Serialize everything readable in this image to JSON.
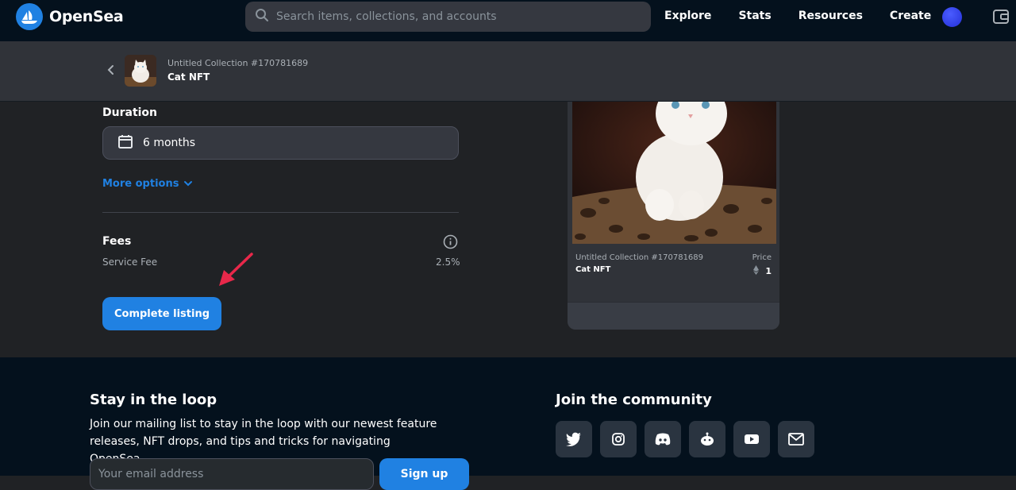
{
  "nav": {
    "logo_text": "OpenSea",
    "search_placeholder": "Search items, collections, and accounts",
    "links": [
      "Explore",
      "Stats",
      "Resources",
      "Create"
    ]
  },
  "subheader": {
    "collection": "Untitled Collection #170781689",
    "name": "Cat NFT"
  },
  "form": {
    "duration_label": "Duration",
    "duration_value": "6 months",
    "more_options": "More options",
    "fees_label": "Fees",
    "service_fee_label": "Service Fee",
    "service_fee_value": "2.5%",
    "complete_button": "Complete listing"
  },
  "preview": {
    "collection": "Untitled Collection #170781689",
    "name": "Cat NFT",
    "price_label": "Price",
    "price_value": "1"
  },
  "footer": {
    "loop_title": "Stay in the loop",
    "loop_desc": "Join our mailing list to stay in the loop with our newest feature releases, NFT drops, and tips and tricks for navigating OpenSea.",
    "email_placeholder": "Your email address",
    "signup": "Sign up",
    "community_title": "Join the community",
    "socials": [
      "twitter-icon",
      "instagram-icon",
      "discord-icon",
      "reddit-icon",
      "youtube-icon",
      "email-icon"
    ]
  },
  "colors": {
    "accent": "#2081e2",
    "nav_bg": "#04111d",
    "page_bg": "#202225",
    "panel_bg": "#303339",
    "annotation_arrow": "#e8284a"
  }
}
